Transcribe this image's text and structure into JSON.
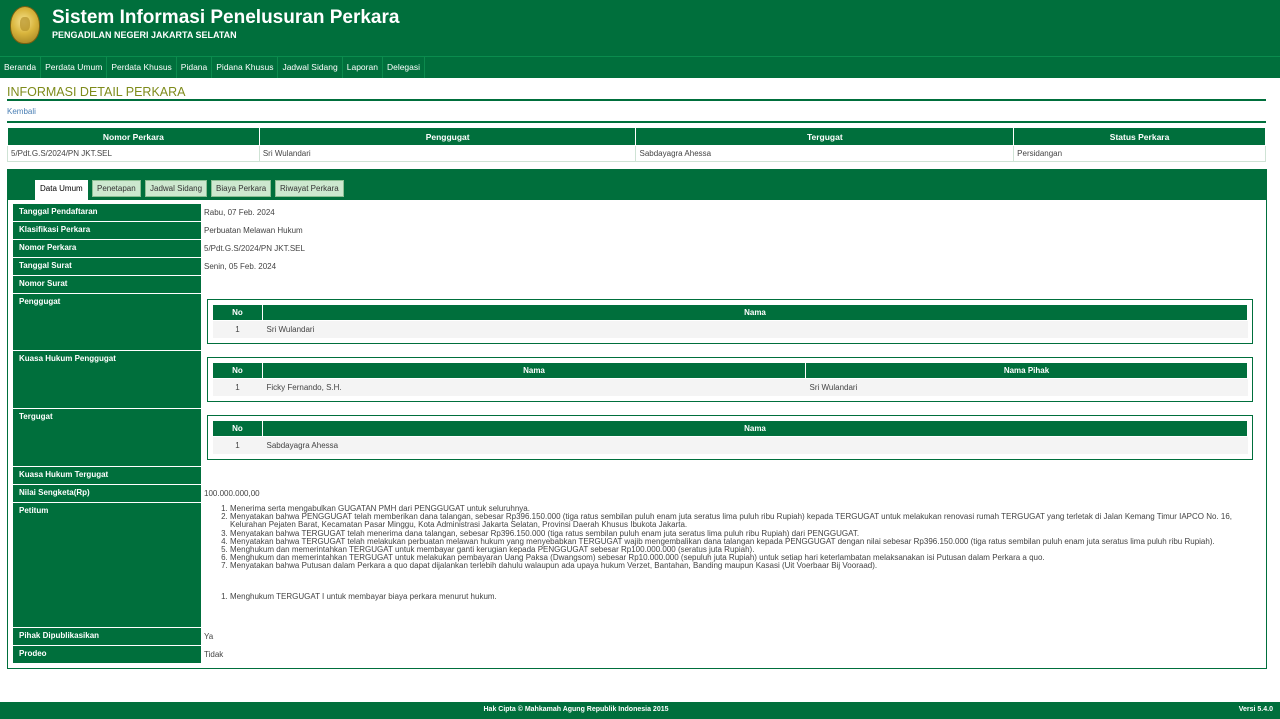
{
  "header": {
    "title": "Sistem Informasi Penelusuran Perkara",
    "subtitle": "PENGADILAN NEGERI JAKARTA SELATAN"
  },
  "nav": [
    "Beranda",
    "Perdata Umum",
    "Perdata Khusus",
    "Pidana",
    "Pidana Khusus",
    "Jadwal Sidang",
    "Laporan",
    "Delegasi"
  ],
  "page": {
    "title": "INFORMASI DETAIL PERKARA",
    "back": "Kembali"
  },
  "summary": {
    "headers": [
      "Nomor Perkara",
      "Penggugat",
      "Tergugat",
      "Status Perkara"
    ],
    "row": [
      "5/Pdt.G.S/2024/PN JKT.SEL",
      "Sri Wulandari",
      "Sabdayagra Ahessa",
      "Persidangan"
    ]
  },
  "tabs": [
    "Data Umum",
    "Penetapan",
    "Jadwal Sidang",
    "Biaya Perkara",
    "Riwayat Perkara"
  ],
  "detail": {
    "labels": {
      "tanggal_pendaftaran": "Tanggal Pendaftaran",
      "klasifikasi": "Klasifikasi Perkara",
      "nomor_perkara": "Nomor Perkara",
      "tanggal_surat": "Tanggal Surat",
      "nomor_surat": "Nomor Surat",
      "penggugat": "Penggugat",
      "kuasa_penggugat": "Kuasa Hukum Penggugat",
      "tergugat": "Tergugat",
      "kuasa_tergugat": "Kuasa Hukum Tergugat",
      "nilai": "Nilai Sengketa(Rp)",
      "petitum": "Petitum",
      "dipublikasikan": "Pihak Dipublikasikan",
      "prodeo": "Prodeo"
    },
    "values": {
      "tanggal_pendaftaran": "Rabu, 07 Feb. 2024",
      "klasifikasi": "Perbuatan Melawan Hukum",
      "nomor_perkara": "5/Pdt.G.S/2024/PN JKT.SEL",
      "tanggal_surat": "Senin, 05 Feb. 2024",
      "nomor_surat": "",
      "nilai": "100.000.000,00",
      "dipublikasikan": "Ya",
      "prodeo": "Tidak"
    },
    "penggugat_table": {
      "headers": [
        "No",
        "Nama"
      ],
      "row": [
        "1",
        "Sri Wulandari"
      ]
    },
    "kuasa_table": {
      "headers": [
        "No",
        "Nama",
        "Nama Pihak"
      ],
      "row": [
        "1",
        "Ficky Fernando, S.H.",
        "Sri Wulandari"
      ]
    },
    "tergugat_table": {
      "headers": [
        "No",
        "Nama"
      ],
      "row": [
        "1",
        "Sabdayagra Ahessa"
      ]
    },
    "petitum": [
      "Menerima serta mengabulkan GUGATAN PMH dari PENGGUGAT untuk seluruhnya.",
      "Menyatakan bahwa PENGGUGAT telah memberikan dana talangan, sebesar Rp396.150.000 (tiga ratus sembilan puluh enam juta seratus lima puluh ribu Rupiah) kepada TERGUGAT untuk melakukan renovasi rumah TERGUGAT yang terletak di Jalan Kemang Timur IAPCO No. 16, Kelurahan Pejaten Barat, Kecamatan Pasar Minggu, Kota Administrasi Jakarta Selatan, Provinsi Daerah Khusus Ibukota Jakarta.",
      "Menyatakan bahwa TERGUGAT telah menerima dana talangan, sebesar Rp396.150.000 (tiga ratus sembilan puluh enam juta seratus lima puluh ribu Rupiah) dari PENGGUGAT.",
      "Menyatakan bahwa TERGUGAT telah melakukan perbuatan melawan hukum yang menyebabkan TERGUGAT wajib mengembalikan dana talangan kepada PENGGUGAT dengan nilai sebesar Rp396.150.000 (tiga ratus sembilan puluh enam juta seratus lima puluh ribu Rupiah).",
      "Menghukum dan memerintahkan TERGUGAT untuk membayar ganti kerugian kepada PENGGUGAT sebesar Rp100.000.000 (seratus juta Rupiah).",
      "Menghukum dan memerintahkan TERGUGAT untuk melakukan pembayaran Uang Paksa (Dwangsom) sebesar Rp10.000.000 (sepuluh juta Rupiah) untuk setiap hari keterlambatan melaksanakan isi Putusan dalam Perkara a quo.",
      "Menyatakan bahwa Putusan dalam Perkara a quo dapat dijalankan terlebih dahulu walaupun ada upaya hukum Verzet, Bantahan, Banding maupun Kasasi (Uit Voerbaar Bij Vooraad)."
    ],
    "petitum_extra": [
      "Menghukum TERGUGAT I untuk membayar biaya perkara menurut hukum."
    ]
  },
  "footer": {
    "copyright": "Hak Cipta © Mahkamah Agung Republik Indonesia 2015",
    "version": "Versi 5.4.0"
  }
}
